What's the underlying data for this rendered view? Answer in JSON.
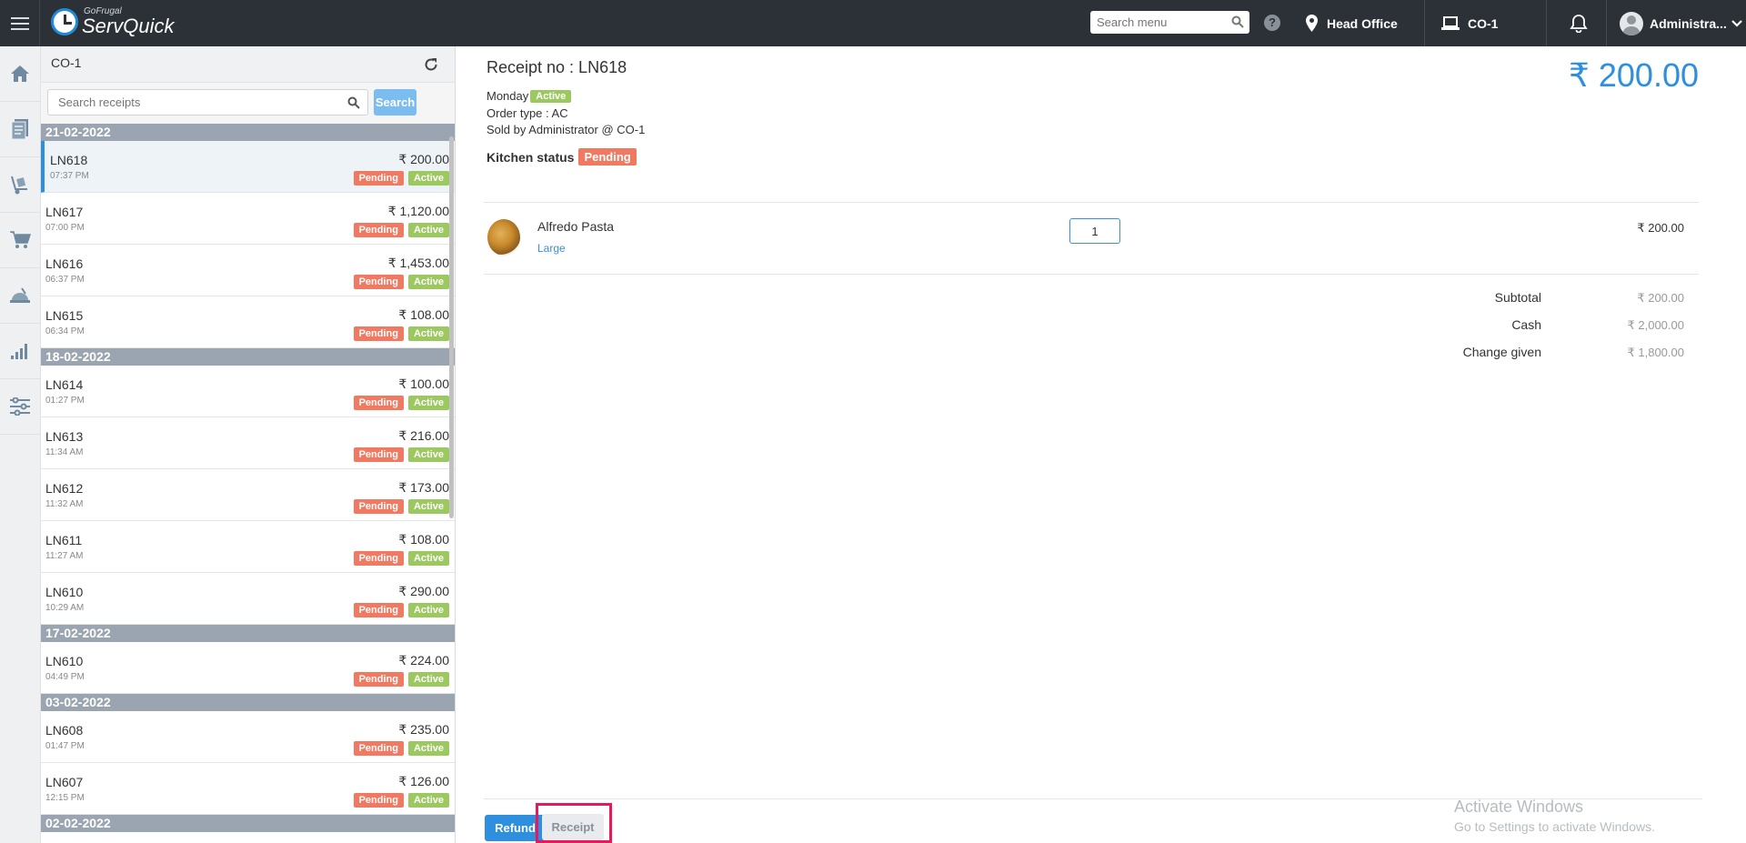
{
  "app": {
    "logo_small": "GoFrugal",
    "logo_big": "ServQuick"
  },
  "topbar": {
    "search_placeholder": "Search menu",
    "help": "?",
    "location": "Head Office",
    "counter": "CO-1",
    "user": "Administra..."
  },
  "list": {
    "title": "CO-1",
    "search_placeholder": "Search receipts",
    "search_button": "Search",
    "pending_label": "Pending",
    "active_label": "Active",
    "groups": [
      {
        "date": "21-02-2022",
        "receipts": [
          {
            "no": "LN618",
            "time": "07:37 PM",
            "amount": "₹ 200.00",
            "selected": true
          },
          {
            "no": "LN617",
            "time": "07:00 PM",
            "amount": "₹ 1,120.00"
          },
          {
            "no": "LN616",
            "time": "06:37 PM",
            "amount": "₹ 1,453.00"
          },
          {
            "no": "LN615",
            "time": "06:34 PM",
            "amount": "₹ 108.00"
          }
        ]
      },
      {
        "date": "18-02-2022",
        "receipts": [
          {
            "no": "LN614",
            "time": "01:27 PM",
            "amount": "₹ 100.00"
          },
          {
            "no": "LN613",
            "time": "11:34 AM",
            "amount": "₹ 216.00"
          },
          {
            "no": "LN612",
            "time": "11:32 AM",
            "amount": "₹ 173.00"
          },
          {
            "no": "LN611",
            "time": "11:27 AM",
            "amount": "₹ 108.00"
          },
          {
            "no": "LN610",
            "time": "10:29 AM",
            "amount": "₹ 290.00"
          }
        ]
      },
      {
        "date": "17-02-2022",
        "receipts": [
          {
            "no": "LN610",
            "time": "04:49 PM",
            "amount": "₹ 224.00"
          }
        ]
      },
      {
        "date": "03-02-2022",
        "receipts": [
          {
            "no": "LN608",
            "time": "01:47 PM",
            "amount": "₹ 235.00"
          },
          {
            "no": "LN607",
            "time": "12:15 PM",
            "amount": "₹ 126.00"
          }
        ]
      },
      {
        "date": "02-02-2022",
        "receipts": []
      }
    ]
  },
  "detail": {
    "title": "Receipt no : LN618",
    "total": "₹ 200.00",
    "day": "Monday",
    "status": "Active",
    "order_type": "Order type : AC",
    "sold_by": "Sold by Administrator @ CO-1",
    "kitchen_label": "Kitchen status",
    "kitchen_status": "Pending",
    "item": {
      "name": "Alfredo Pasta",
      "variant": "Large",
      "qty": "1",
      "price": "₹ 200.00"
    },
    "summary": [
      {
        "label": "Subtotal",
        "value": "₹ 200.00"
      },
      {
        "label": "Cash",
        "value": "₹ 2,000.00"
      },
      {
        "label": "Change given",
        "value": "₹ 1,800.00"
      }
    ],
    "refund_button": "Refund",
    "receipt_button": "Receipt"
  },
  "watermark": {
    "line1": "Activate Windows",
    "line2": "Go to Settings to activate Windows."
  },
  "colors": {
    "accent": "#2f8fdf",
    "pending": "#f27961",
    "active": "#9cc860",
    "highlight": "#e8185f"
  }
}
